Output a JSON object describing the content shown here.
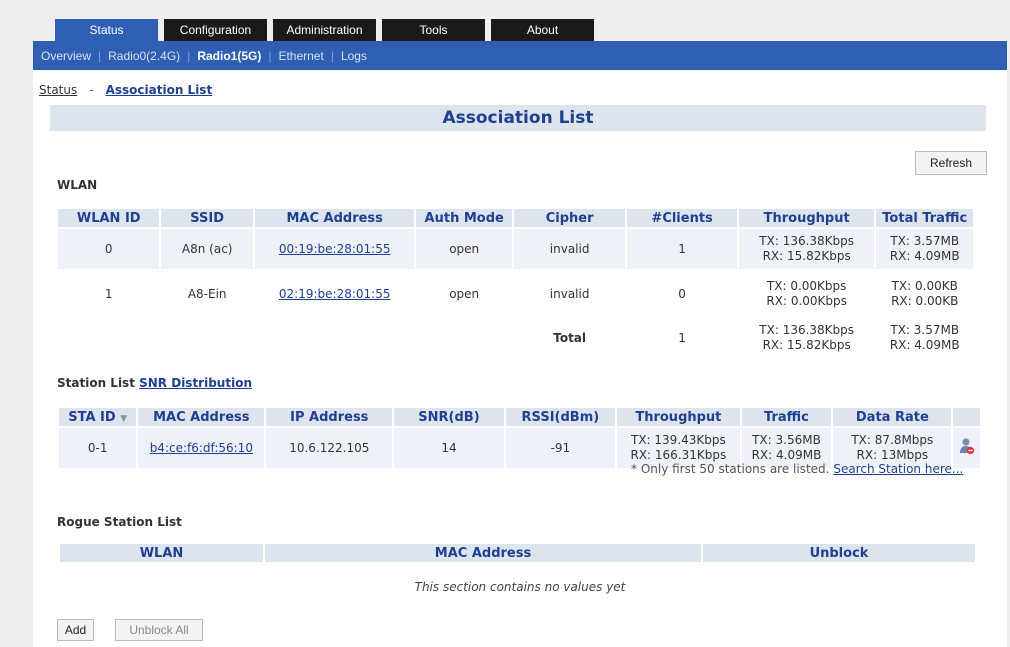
{
  "top_tabs": [
    "Status",
    "Configuration",
    "Administration",
    "Tools",
    "About"
  ],
  "subnav": [
    "Overview",
    "Radio0(2.4G)",
    "Radio1(5G)",
    "Ethernet",
    "Logs"
  ],
  "breadcrumb": {
    "root": "Status",
    "sep": "-",
    "current": "Association List"
  },
  "page_title": "Association List",
  "refresh_label": "Refresh",
  "wlan": {
    "title": "WLAN",
    "headers": [
      "WLAN ID",
      "SSID",
      "MAC Address",
      "Auth Mode",
      "Cipher",
      "#Clients",
      "Throughput",
      "Total Traffic"
    ],
    "rows": [
      {
        "id": "0",
        "ssid": "A8n (ac)",
        "mac": "00:19:be:28:01:55",
        "auth": "open",
        "cipher": "invalid",
        "clients": "1",
        "tx": "TX: 136.38Kbps",
        "rx": "RX: 15.82Kbps",
        "ttx": "TX: 3.57MB",
        "trx": "RX: 4.09MB"
      },
      {
        "id": "1",
        "ssid": "A8-Ein",
        "mac": "02:19:be:28:01:55",
        "auth": "open",
        "cipher": "invalid",
        "clients": "0",
        "tx": "TX: 0.00Kbps",
        "rx": "RX: 0.00Kbps",
        "ttx": "TX: 0.00KB",
        "trx": "RX: 0.00KB"
      }
    ],
    "total": {
      "label": "Total",
      "clients": "1",
      "tx": "TX: 136.38Kbps",
      "rx": "RX: 15.82Kbps",
      "ttx": "TX: 3.57MB",
      "trx": "RX: 4.09MB"
    }
  },
  "station": {
    "title": "Station List",
    "snr_link": "SNR Distribution",
    "headers": [
      "STA ID",
      "MAC Address",
      "IP Address",
      "SNR(dB)",
      "RSSI(dBm)",
      "Throughput",
      "Traffic",
      "Data Rate"
    ],
    "sort_glyph": "▼",
    "rows": [
      {
        "id": "0-1",
        "mac": "b4:ce:f6:df:56:10",
        "ip": "10.6.122.105",
        "snr": "14",
        "rssi": "-91",
        "tx": "TX: 139.43Kbps",
        "rx": "RX: 166.31Kbps",
        "ttx": "TX: 3.56MB",
        "trx": "RX: 4.09MB",
        "rate_tx": "TX: 87.8Mbps",
        "rate_rx": "RX: 13Mbps"
      }
    ],
    "note": "* Only first 50 stations are listed.",
    "search_link": "Search Station here..."
  },
  "rogue": {
    "title": "Rogue Station List",
    "headers": [
      "WLAN",
      "MAC Address",
      "Unblock"
    ],
    "empty": "This section contains no values yet"
  },
  "add_label": "Add",
  "unblock_all_label": "Unblock All",
  "colors": {
    "nav_blue": "#2f5fb3",
    "header_bg": "#dde4ee",
    "header_text": "#1f3f8f"
  }
}
